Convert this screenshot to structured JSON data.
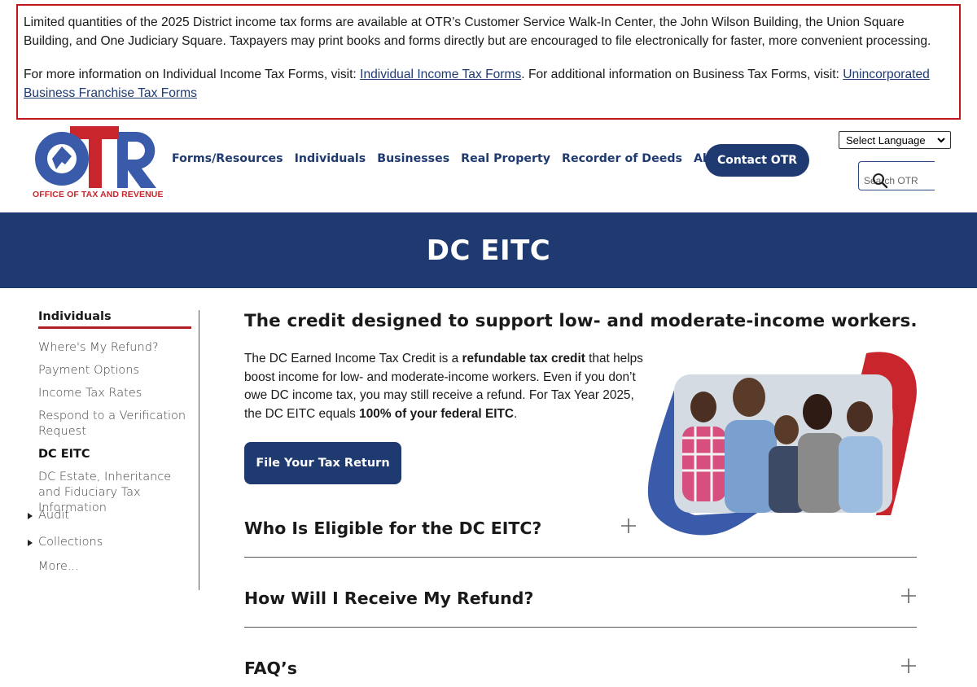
{
  "alert": {
    "line1": "Limited quantities of the 2025 District income tax forms are available at OTR’s Customer Service Walk-In Center, the John Wilson Building, the Union Square Building, and One Judiciary Square. Taxpayers may print books and forms directly but are encouraged to file electronically for faster, more convenient processing.",
    "line2_prefix": "For more information on Individual Income Tax Forms, visit: ",
    "line2_link1": "Individual Income Tax Forms",
    "line2_middle": ". For additional information on Business Tax Forms, visit: ",
    "line2_link2": "Unincorporated Business Franchise Tax Forms"
  },
  "header": {
    "logo_text": "OTR",
    "logo_caption": "OFFICE OF TAX AND REVENUE",
    "nav": [
      "Forms/Resources",
      "Individuals",
      "Businesses",
      "Real Property",
      "Recorder of Deeds",
      "About OTR"
    ],
    "contact_label": "Contact OTR",
    "language_select": "Select Language",
    "search_placeholder": "Search OTR"
  },
  "hero": {
    "title": "DC EITC"
  },
  "sidebar": {
    "heading": "Individuals",
    "items": [
      {
        "label": "Where's My Refund?"
      },
      {
        "label": "Payment Options"
      },
      {
        "label": "Income Tax Rates"
      },
      {
        "label": "Respond to a Verification Request"
      },
      {
        "label": "DC EITC"
      },
      {
        "label": "DC Estate, Inheritance and Fiduciary Tax Information"
      },
      {
        "label": "Audit"
      },
      {
        "label": "Collections"
      },
      {
        "label": "More..."
      }
    ]
  },
  "main": {
    "heading": "The credit designed to support low- and moderate-income workers.",
    "intro_1": "The DC Earned Income Tax Credit is a ",
    "intro_bold1": "refundable tax credit",
    "intro_2": " that helps boost income for low- and moderate-income workers. Even if you don’t owe DC income tax, you may still receive a refund. For Tax Year 2025, the DC EITC equals ",
    "intro_bold2": "100% of your federal EITC",
    "intro_3": ".",
    "file_button": "File Your Tax Return",
    "accordion": [
      {
        "title": "Who Is Eligible for the DC EITC?"
      },
      {
        "title": "How Will I Receive My Refund?"
      },
      {
        "title": "FAQ’s"
      }
    ]
  },
  "colors": {
    "navy": "#1f3a70",
    "red": "#c8262c",
    "blue": "#3a5ba9"
  }
}
